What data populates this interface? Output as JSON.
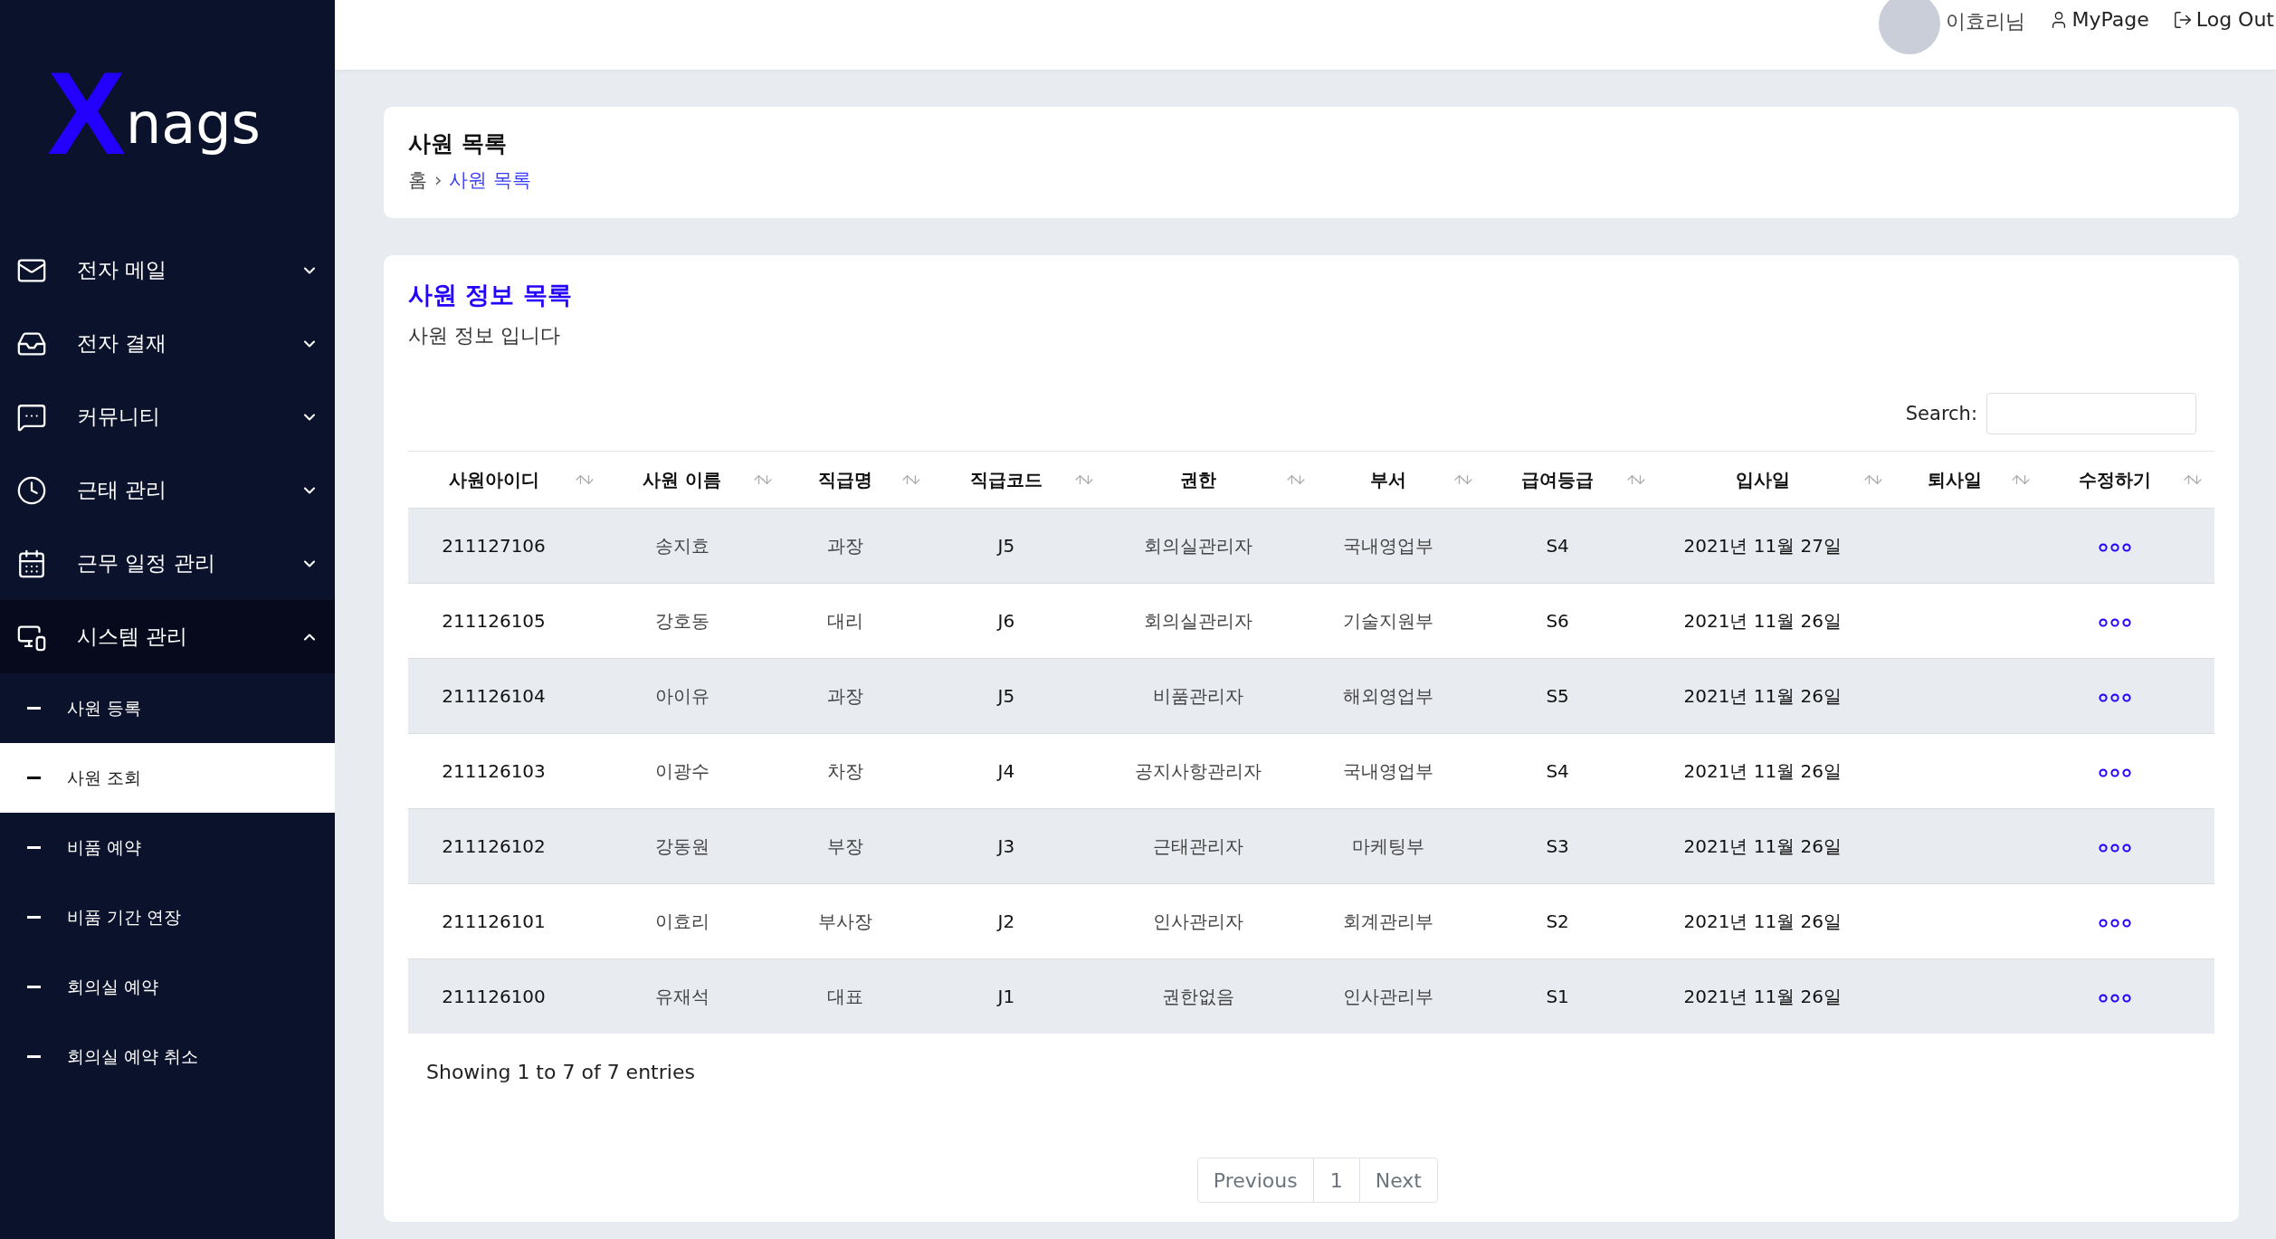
{
  "logo": {
    "mark": "X",
    "text": "nags"
  },
  "sidebar": {
    "items": [
      {
        "label": "전자 메일",
        "expanded": false
      },
      {
        "label": "전자 결재",
        "expanded": false
      },
      {
        "label": "커뮤니티",
        "expanded": false
      },
      {
        "label": "근태 관리",
        "expanded": false
      },
      {
        "label": "근무 일정 관리",
        "expanded": false
      },
      {
        "label": "시스템 관리",
        "expanded": true,
        "children": [
          {
            "label": "사원 등록",
            "selected": false
          },
          {
            "label": "사원 조회",
            "selected": true
          },
          {
            "label": "비품 예약",
            "selected": false
          },
          {
            "label": "비품 기간 연장",
            "selected": false
          },
          {
            "label": "회의실 예약",
            "selected": false
          },
          {
            "label": "회의실 예약 취소",
            "selected": false
          }
        ]
      }
    ]
  },
  "header": {
    "user": "이효리님",
    "links": [
      "MyPage",
      "Log Out"
    ]
  },
  "page_title": "사원 목록",
  "breadcrumb": [
    {
      "label": "홈",
      "selected": false
    },
    {
      "label": "사원 목록",
      "selected": true
    }
  ],
  "breadcrumb_separator": "›",
  "card": {
    "title": "사원 정보 목록",
    "subtitle": "사원 정보 입니다"
  },
  "search": {
    "label": "Search:"
  },
  "table": {
    "columns": [
      "사원아이디",
      "사원 이름",
      "직급명",
      "직급코드",
      "권한",
      "부서",
      "급여등급",
      "입사일",
      "퇴사일",
      "수정하기"
    ],
    "rows": [
      [
        "211127106",
        "송지효",
        "과장",
        "J5",
        "회의실관리자",
        "국내영업부",
        "S4",
        "2021년 11월 27일",
        ""
      ],
      [
        "211126105",
        "강호동",
        "대리",
        "J6",
        "회의실관리자",
        "기술지원부",
        "S6",
        "2021년 11월 26일",
        ""
      ],
      [
        "211126104",
        "아이유",
        "과장",
        "J5",
        "비품관리자",
        "해외영업부",
        "S5",
        "2021년 11월 26일",
        ""
      ],
      [
        "211126103",
        "이광수",
        "차장",
        "J4",
        "공지사항관리자",
        "국내영업부",
        "S4",
        "2021년 11월 26일",
        ""
      ],
      [
        "211126102",
        "강동원",
        "부장",
        "J3",
        "근태관리자",
        "마케팅부",
        "S3",
        "2021년 11월 26일",
        ""
      ],
      [
        "211126101",
        "이효리",
        "부사장",
        "J2",
        "인사관리자",
        "회계관리부",
        "S2",
        "2021년 11월 26일",
        ""
      ],
      [
        "211126100",
        "유재석",
        "대표",
        "J1",
        "권한없음",
        "인사관리부",
        "S1",
        "2021년 11월 26일",
        ""
      ]
    ]
  },
  "info": "Showing 1 to 7 of 7 entries",
  "pagination": [
    {
      "label": "Previous",
      "kind": "prev"
    },
    {
      "label": "1",
      "kind": "page"
    },
    {
      "label": "Next",
      "kind": "next"
    }
  ]
}
